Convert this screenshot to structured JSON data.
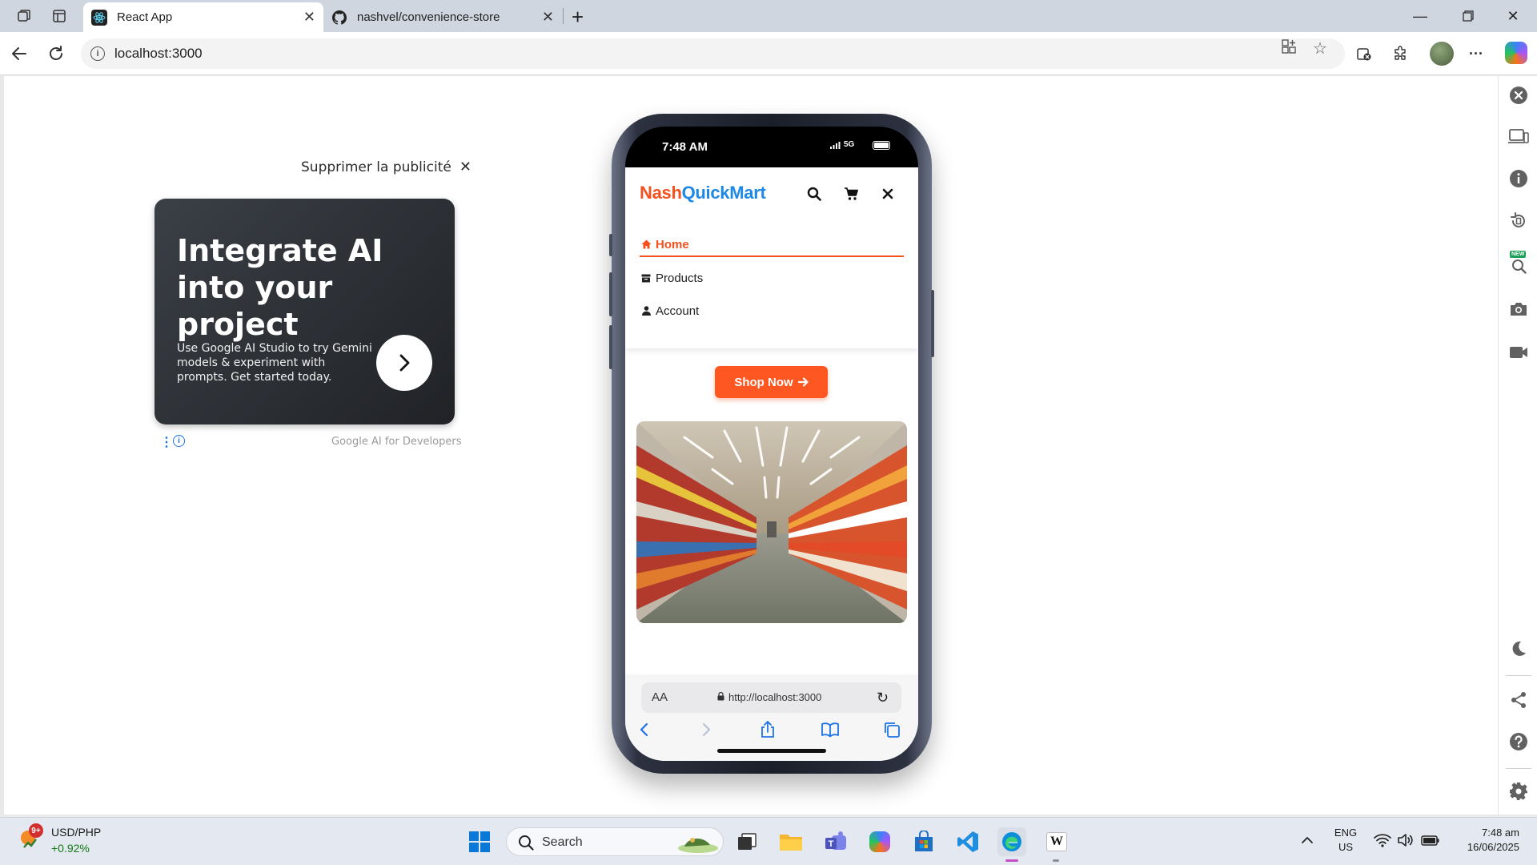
{
  "browser": {
    "tabs": [
      {
        "title": "React App",
        "active": true
      },
      {
        "title": "nashvel/convenience-store",
        "active": false
      }
    ],
    "address": "localhost:3000"
  },
  "ad": {
    "remove_label": "Supprimer la publicité",
    "title": "Integrate AI into your project",
    "text": "Use Google AI Studio to try Gemini models & experiment with prompts. Get started today.",
    "brand": "Google AI for Developers"
  },
  "phone": {
    "status_time": "7:48 AM",
    "network": "5G",
    "brand_part1": "Nash",
    "brand_part2": "QuickMart",
    "menu": [
      {
        "label": "Home",
        "icon": "home-icon",
        "active": true
      },
      {
        "label": "Products",
        "icon": "box-icon",
        "active": false
      },
      {
        "label": "Account",
        "icon": "user-icon",
        "active": false
      }
    ],
    "cta_label": "Shop Now",
    "safari": {
      "text_size": "AA",
      "url": "http://localhost:3000"
    }
  },
  "taskbar": {
    "notification_count": "9+",
    "ticker_title": "USD/PHP",
    "ticker_change": "+0.92%",
    "search_label": "Search",
    "lang_line1": "ENG",
    "lang_line2": "US",
    "clock_time": "7:48 am",
    "clock_date": "16/06/2025"
  },
  "colors": {
    "accent_orange": "#ff5722",
    "brand_red": "#f4511e",
    "brand_blue": "#1e88e5",
    "ticker_green": "#107c10"
  }
}
